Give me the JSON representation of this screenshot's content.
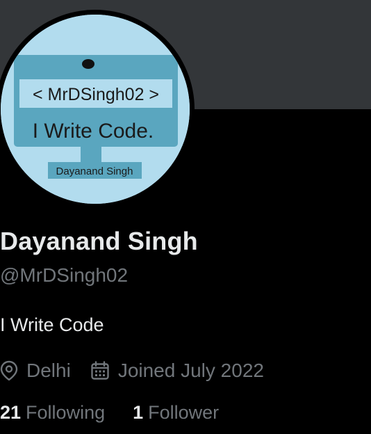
{
  "profile": {
    "display_name": "Dayanand Singh",
    "handle": "@MrDSingh02",
    "bio": "I Write Code",
    "location": "Delhi",
    "joined": "Joined July 2022"
  },
  "avatar": {
    "line1": "< MrDSingh02 >",
    "line2": "I Write Code.",
    "caption": "Dayanand Singh"
  },
  "stats": {
    "following_count": "21",
    "following_label": "Following",
    "followers_count": "1",
    "followers_label": "Follower"
  },
  "colors": {
    "background": "#000000",
    "banner": "#333639",
    "primary_text": "#e7e9ea",
    "secondary_text": "#71767b",
    "avatar_bg": "#b2dcee",
    "avatar_monitor": "#5aa6bf"
  },
  "icons": {
    "location": "location-pin-icon",
    "joined": "calendar-icon"
  }
}
